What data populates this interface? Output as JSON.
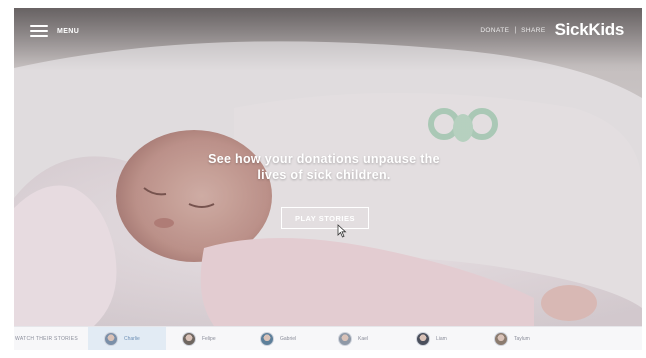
{
  "header": {
    "menu_label": "MENU",
    "donate_label": "DONATE",
    "separator": "|",
    "share_label": "SHARE",
    "brand": "SickKids"
  },
  "hero": {
    "headline_line1": "See how your donations unpause the",
    "headline_line2": "lives of sick children.",
    "play_label": "PLAY STORIES"
  },
  "stories": {
    "label": "WATCH THEIR STORIES",
    "items": [
      {
        "name": "Charlie",
        "active": true,
        "color": "#7a8fa8"
      },
      {
        "name": "Felipe",
        "active": false,
        "color": "#6e6660"
      },
      {
        "name": "Gabriel",
        "active": false,
        "color": "#5d7f9a"
      },
      {
        "name": "Kael",
        "active": false,
        "color": "#8e98a6"
      },
      {
        "name": "Liam",
        "active": false,
        "color": "#4a4f5c"
      },
      {
        "name": "Taylum",
        "active": false,
        "color": "#8b7b6f"
      }
    ]
  },
  "colors": {
    "active_strip": "#e2ebf4",
    "overlay": "#000000",
    "text": "#ffffff"
  }
}
